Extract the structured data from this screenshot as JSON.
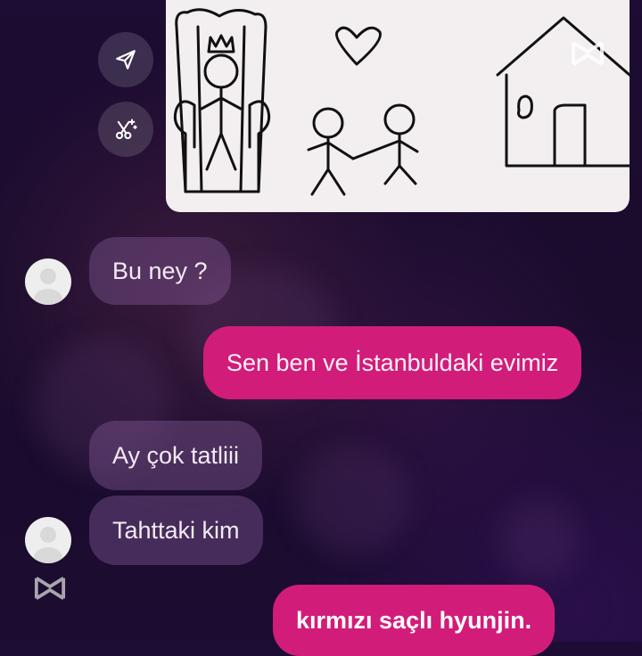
{
  "chat": {
    "messages": [
      {
        "side": "incoming",
        "text": "Bu ney ?"
      },
      {
        "side": "outgoing",
        "text": "Sen ben ve İstanbuldaki evimiz"
      },
      {
        "side": "incoming",
        "text": "Ay çok tatliii"
      },
      {
        "side": "incoming",
        "text": "Tahttaki kim"
      },
      {
        "side": "outgoing",
        "text": "kırmızı saçlı hyunjin."
      }
    ]
  },
  "actions": {
    "share_icon": "paper-plane-icon",
    "edit_icon": "scissors-sparkle-icon"
  },
  "icons": {
    "watermark": "capcut-logo-icon"
  },
  "colors": {
    "outgoing_bubble": "#d21c7a",
    "incoming_bubble": "#6b4a7a",
    "background": "#1d0c33"
  }
}
